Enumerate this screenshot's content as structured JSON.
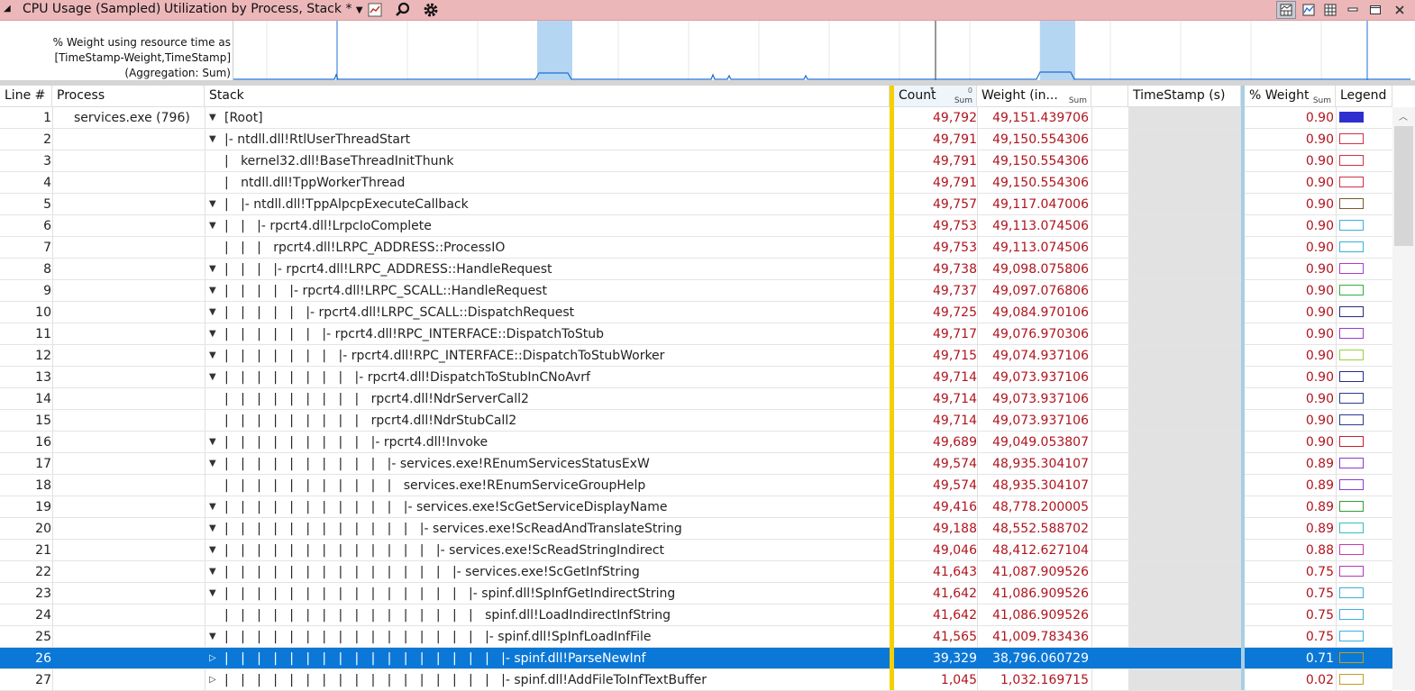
{
  "window": {
    "collapse_glyph": "◢",
    "title": "CPU Usage (Sampled)",
    "preset": "Utilization by Process, Stack *",
    "preset_dropdown_glyph": "▼"
  },
  "graph": {
    "label": "% Weight using resource time as [TimeStamp-Weight,TimeStamp] (Aggregation: Sum)"
  },
  "columns": {
    "line": "Line #",
    "process": "Process",
    "stack": "Stack",
    "count": "Count",
    "count_agg": "Sum",
    "weight": "Weight (in...",
    "weight_agg": "Sum",
    "timestamp": "TimeStamp (s)",
    "pct_weight": "% Weight",
    "pct_weight_agg": "Sum",
    "legend": "Legend"
  },
  "colors": {
    "title_bar": "#ecb7b9",
    "selection": "#0b78d7",
    "value_text": "#b0151e",
    "graph_highlight": "#b5d6f2",
    "graph_line": "#1d6fd6"
  },
  "icons": [
    "chart-settings-icon",
    "search-icon",
    "gear-icon",
    "graph-and-table-view-icon",
    "graph-only-view-icon",
    "table-only-view-icon",
    "minimize-icon",
    "maximize-icon",
    "close-icon"
  ],
  "rows": [
    {
      "line": "1",
      "process": "services.exe (796)",
      "expander": "▼",
      "stack": "[Root]",
      "count": "49,792",
      "weight": "49,151.439706",
      "pct": "0.90",
      "legend": "#2f2fd0",
      "legend_fill": "#2f2fd0"
    },
    {
      "line": "2",
      "process": "",
      "expander": "▼",
      "stack": "|- ntdll.dll!RtlUserThreadStart",
      "count": "49,791",
      "weight": "49,150.554306",
      "pct": "0.90",
      "legend": "#d0304a"
    },
    {
      "line": "3",
      "process": "",
      "expander": "",
      "stack": "|   kernel32.dll!BaseThreadInitThunk",
      "count": "49,791",
      "weight": "49,150.554306",
      "pct": "0.90",
      "legend": "#d0304a"
    },
    {
      "line": "4",
      "process": "",
      "expander": "",
      "stack": "|   ntdll.dll!TppWorkerThread",
      "count": "49,791",
      "weight": "49,150.554306",
      "pct": "0.90",
      "legend": "#d0304a"
    },
    {
      "line": "5",
      "process": "",
      "expander": "▼",
      "stack": "|   |- ntdll.dll!TppAlpcpExecuteCallback",
      "count": "49,757",
      "weight": "49,117.047006",
      "pct": "0.90",
      "legend": "#7a5a2a"
    },
    {
      "line": "6",
      "process": "",
      "expander": "▼",
      "stack": "|   |   |- rpcrt4.dll!LrpcIoComplete",
      "count": "49,753",
      "weight": "49,113.074506",
      "pct": "0.90",
      "legend": "#3ab0e0"
    },
    {
      "line": "7",
      "process": "",
      "expander": "",
      "stack": "|   |   |   rpcrt4.dll!LRPC_ADDRESS::ProcessIO",
      "count": "49,753",
      "weight": "49,113.074506",
      "pct": "0.90",
      "legend": "#3ab0e0"
    },
    {
      "line": "8",
      "process": "",
      "expander": "▼",
      "stack": "|   |   |   |- rpcrt4.dll!LRPC_ADDRESS::HandleRequest",
      "count": "49,738",
      "weight": "49,098.075806",
      "pct": "0.90",
      "legend": "#b03ad0"
    },
    {
      "line": "9",
      "process": "",
      "expander": "▼",
      "stack": "|   |   |   |   |- rpcrt4.dll!LRPC_SCALL::HandleRequest",
      "count": "49,737",
      "weight": "49,097.076806",
      "pct": "0.90",
      "legend": "#30b040"
    },
    {
      "line": "10",
      "process": "",
      "expander": "▼",
      "stack": "|   |   |   |   |   |- rpcrt4.dll!LRPC_SCALL::DispatchRequest",
      "count": "49,725",
      "weight": "49,084.970106",
      "pct": "0.90",
      "legend": "#2a2a80"
    },
    {
      "line": "11",
      "process": "",
      "expander": "▼",
      "stack": "|   |   |   |   |   |   |- rpcrt4.dll!RPC_INTERFACE::DispatchToStub",
      "count": "49,717",
      "weight": "49,076.970306",
      "pct": "0.90",
      "legend": "#9a3ad0"
    },
    {
      "line": "12",
      "process": "",
      "expander": "▼",
      "stack": "|   |   |   |   |   |   |   |- rpcrt4.dll!RPC_INTERFACE::DispatchToStubWorker",
      "count": "49,715",
      "weight": "49,074.937106",
      "pct": "0.90",
      "legend": "#9ad040"
    },
    {
      "line": "13",
      "process": "",
      "expander": "▼",
      "stack": "|   |   |   |   |   |   |   |   |- rpcrt4.dll!DispatchToStubInCNoAvrf",
      "count": "49,714",
      "weight": "49,073.937106",
      "pct": "0.90",
      "legend": "#2a2a90"
    },
    {
      "line": "14",
      "process": "",
      "expander": "",
      "stack": "|   |   |   |   |   |   |   |   |   rpcrt4.dll!NdrServerCall2",
      "count": "49,714",
      "weight": "49,073.937106",
      "pct": "0.90",
      "legend": "#2a3a90"
    },
    {
      "line": "15",
      "process": "",
      "expander": "",
      "stack": "|   |   |   |   |   |   |   |   |   rpcrt4.dll!NdrStubCall2",
      "count": "49,714",
      "weight": "49,073.937106",
      "pct": "0.90",
      "legend": "#2a3a90"
    },
    {
      "line": "16",
      "process": "",
      "expander": "▼",
      "stack": "|   |   |   |   |   |   |   |   |   |- rpcrt4.dll!Invoke",
      "count": "49,689",
      "weight": "49,049.053807",
      "pct": "0.90",
      "legend": "#c02030"
    },
    {
      "line": "17",
      "process": "",
      "expander": "▼",
      "stack": "|   |   |   |   |   |   |   |   |   |   |- services.exe!REnumServicesStatusExW",
      "count": "49,574",
      "weight": "48,935.304107",
      "pct": "0.89",
      "legend": "#8a3ad0"
    },
    {
      "line": "18",
      "process": "",
      "expander": "",
      "stack": "|   |   |   |   |   |   |   |   |   |   |   services.exe!REnumServiceGroupHelp",
      "count": "49,574",
      "weight": "48,935.304107",
      "pct": "0.89",
      "legend": "#8a3ad0"
    },
    {
      "line": "19",
      "process": "",
      "expander": "▼",
      "stack": "|   |   |   |   |   |   |   |   |   |   |   |- services.exe!ScGetServiceDisplayName",
      "count": "49,416",
      "weight": "48,778.200005",
      "pct": "0.89",
      "legend": "#30a030"
    },
    {
      "line": "20",
      "process": "",
      "expander": "▼",
      "stack": "|   |   |   |   |   |   |   |   |   |   |   |   |- services.exe!ScReadAndTranslateString",
      "count": "49,188",
      "weight": "48,552.588702",
      "pct": "0.89",
      "legend": "#30c0c0"
    },
    {
      "line": "21",
      "process": "",
      "expander": "▼",
      "stack": "|   |   |   |   |   |   |   |   |   |   |   |   |   |- services.exe!ScReadStringIndirect",
      "count": "49,046",
      "weight": "48,412.627104",
      "pct": "0.88",
      "legend": "#c03ab0"
    },
    {
      "line": "22",
      "process": "",
      "expander": "▼",
      "stack": "|   |   |   |   |   |   |   |   |   |   |   |   |   |   |- services.exe!ScGetInfString",
      "count": "41,643",
      "weight": "41,087.909526",
      "pct": "0.75",
      "legend": "#b03ac0"
    },
    {
      "line": "23",
      "process": "",
      "expander": "▼",
      "stack": "|   |   |   |   |   |   |   |   |   |   |   |   |   |   |   |- spinf.dll!SpInfGetIndirectString",
      "count": "41,642",
      "weight": "41,086.909526",
      "pct": "0.75",
      "legend": "#3ab0e0"
    },
    {
      "line": "24",
      "process": "",
      "expander": "",
      "stack": "|   |   |   |   |   |   |   |   |   |   |   |   |   |   |   |   spinf.dll!LoadIndirectInfString",
      "count": "41,642",
      "weight": "41,086.909526",
      "pct": "0.75",
      "legend": "#3ab0e0"
    },
    {
      "line": "25",
      "process": "",
      "expander": "▼",
      "stack": "|   |   |   |   |   |   |   |   |   |   |   |   |   |   |   |   |- spinf.dll!SpInfLoadInfFile",
      "count": "41,565",
      "weight": "41,009.783436",
      "pct": "0.75",
      "legend": "#3ab0e0"
    },
    {
      "line": "26",
      "process": "",
      "expander": "▷",
      "stack": "|   |   |   |   |   |   |   |   |   |   |   |   |   |   |   |   |   |- spinf.dll!ParseNewInf",
      "count": "39,329",
      "weight": "38,796.060729",
      "pct": "0.71",
      "legend": "#c0a020",
      "selected": true
    },
    {
      "line": "27",
      "process": "",
      "expander": "▷",
      "stack": "|   |   |   |   |   |   |   |   |   |   |   |   |   |   |   |   |   |- spinf.dll!AddFileToInfTextBuffer",
      "count": "1,045",
      "weight": "1,032.169715",
      "pct": "0.02",
      "legend": "#c0a020"
    }
  ]
}
